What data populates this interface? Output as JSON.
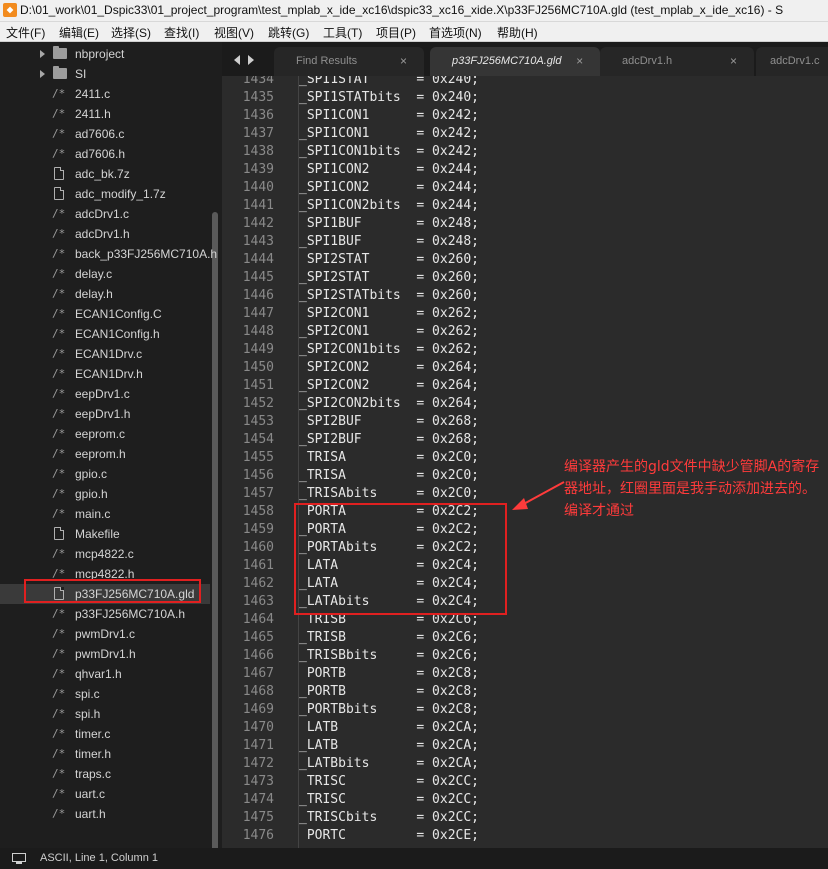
{
  "window": {
    "title": "D:\\01_work\\01_Dspic33\\01_project_program\\test_mplab_x_ide_xc16\\dspic33_xc16_xide.X\\p33FJ256MC710A.gld (test_mplab_x_ide_xc16) - S"
  },
  "menu": [
    "文件(F)",
    "编辑(E)",
    "选择(S)",
    "查找(I)",
    "视图(V)",
    "跳转(G)",
    "工具(T)",
    "项目(P)",
    "首选项(N)",
    "帮助(H)"
  ],
  "sidebar": {
    "items": [
      {
        "label": "nbproject",
        "type": "folder"
      },
      {
        "label": "SI",
        "type": "folder"
      },
      {
        "label": "2411.c",
        "type": "code"
      },
      {
        "label": "2411.h",
        "type": "code"
      },
      {
        "label": "ad7606.c",
        "type": "code"
      },
      {
        "label": "ad7606.h",
        "type": "code"
      },
      {
        "label": "adc_bk.7z",
        "type": "file"
      },
      {
        "label": "adc_modify_1.7z",
        "type": "file"
      },
      {
        "label": "adcDrv1.c",
        "type": "code"
      },
      {
        "label": "adcDrv1.h",
        "type": "code"
      },
      {
        "label": "back_p33FJ256MC710A.h",
        "type": "code"
      },
      {
        "label": "delay.c",
        "type": "code"
      },
      {
        "label": "delay.h",
        "type": "code"
      },
      {
        "label": "ECAN1Config.C",
        "type": "code"
      },
      {
        "label": "ECAN1Config.h",
        "type": "code"
      },
      {
        "label": "ECAN1Drv.c",
        "type": "code"
      },
      {
        "label": "ECAN1Drv.h",
        "type": "code"
      },
      {
        "label": "eepDrv1.c",
        "type": "code"
      },
      {
        "label": "eepDrv1.h",
        "type": "code"
      },
      {
        "label": "eeprom.c",
        "type": "code"
      },
      {
        "label": "eeprom.h",
        "type": "code"
      },
      {
        "label": "gpio.c",
        "type": "code"
      },
      {
        "label": "gpio.h",
        "type": "code"
      },
      {
        "label": "main.c",
        "type": "code"
      },
      {
        "label": "Makefile",
        "type": "file"
      },
      {
        "label": "mcp4822.c",
        "type": "code"
      },
      {
        "label": "mcp4822.h",
        "type": "code"
      },
      {
        "label": "p33FJ256MC710A.gld",
        "type": "file",
        "selected": true
      },
      {
        "label": "p33FJ256MC710A.h",
        "type": "code"
      },
      {
        "label": "pwmDrv1.c",
        "type": "code"
      },
      {
        "label": "pwmDrv1.h",
        "type": "code"
      },
      {
        "label": "qhvar1.h",
        "type": "code"
      },
      {
        "label": "spi.c",
        "type": "code"
      },
      {
        "label": "spi.h",
        "type": "code"
      },
      {
        "label": "timer.c",
        "type": "code"
      },
      {
        "label": "timer.h",
        "type": "code"
      },
      {
        "label": "traps.c",
        "type": "code"
      },
      {
        "label": "uart.c",
        "type": "code"
      },
      {
        "label": "uart.h",
        "type": "code"
      }
    ]
  },
  "tabs": [
    {
      "label": "Find Results",
      "active": false
    },
    {
      "label": "p33FJ256MC710A.gld",
      "active": true
    },
    {
      "label": "adcDrv1.h",
      "active": false
    },
    {
      "label": "adcDrv1.c",
      "active": false
    }
  ],
  "tab_close_glyph": "×",
  "code": [
    {
      "ln": "1434",
      "text": "_SPI1STAT      = 0x240;"
    },
    {
      "ln": "1435",
      "text": "_SPI1STATbits  = 0x240;"
    },
    {
      "ln": "1436",
      "text": " SPI1CON1      = 0x242;"
    },
    {
      "ln": "1437",
      "text": "_SPI1CON1      = 0x242;"
    },
    {
      "ln": "1438",
      "text": "_SPI1CON1bits  = 0x242;"
    },
    {
      "ln": "1439",
      "text": " SPI1CON2      = 0x244;"
    },
    {
      "ln": "1440",
      "text": "_SPI1CON2      = 0x244;"
    },
    {
      "ln": "1441",
      "text": "_SPI1CON2bits  = 0x244;"
    },
    {
      "ln": "1442",
      "text": " SPI1BUF       = 0x248;"
    },
    {
      "ln": "1443",
      "text": "_SPI1BUF       = 0x248;"
    },
    {
      "ln": "1444",
      "text": " SPI2STAT      = 0x260;"
    },
    {
      "ln": "1445",
      "text": "_SPI2STAT      = 0x260;"
    },
    {
      "ln": "1446",
      "text": "_SPI2STATbits  = 0x260;"
    },
    {
      "ln": "1447",
      "text": " SPI2CON1      = 0x262;"
    },
    {
      "ln": "1448",
      "text": "_SPI2CON1      = 0x262;"
    },
    {
      "ln": "1449",
      "text": "_SPI2CON1bits  = 0x262;"
    },
    {
      "ln": "1450",
      "text": " SPI2CON2      = 0x264;"
    },
    {
      "ln": "1451",
      "text": "_SPI2CON2      = 0x264;"
    },
    {
      "ln": "1452",
      "text": "_SPI2CON2bits  = 0x264;"
    },
    {
      "ln": "1453",
      "text": " SPI2BUF       = 0x268;"
    },
    {
      "ln": "1454",
      "text": "_SPI2BUF       = 0x268;"
    },
    {
      "ln": "1455",
      "text": " TRISA         = 0x2C0;"
    },
    {
      "ln": "1456",
      "text": "_TRISA         = 0x2C0;"
    },
    {
      "ln": "1457",
      "text": "_TRISAbits     = 0x2C0;"
    },
    {
      "ln": "1458",
      "text": " PORTA         = 0x2C2;"
    },
    {
      "ln": "1459",
      "text": "_PORTA         = 0x2C2;"
    },
    {
      "ln": "1460",
      "text": "_PORTAbits     = 0x2C2;"
    },
    {
      "ln": "1461",
      "text": " LATA          = 0x2C4;"
    },
    {
      "ln": "1462",
      "text": "_LATA          = 0x2C4;"
    },
    {
      "ln": "1463",
      "text": "_LATAbits      = 0x2C4;"
    },
    {
      "ln": "1464",
      "text": " TRISB         = 0x2C6;"
    },
    {
      "ln": "1465",
      "text": "_TRISB         = 0x2C6;"
    },
    {
      "ln": "1466",
      "text": "_TRISBbits     = 0x2C6;"
    },
    {
      "ln": "1467",
      "text": " PORTB         = 0x2C8;"
    },
    {
      "ln": "1468",
      "text": "_PORTB         = 0x2C8;"
    },
    {
      "ln": "1469",
      "text": "_PORTBbits     = 0x2C8;"
    },
    {
      "ln": "1470",
      "text": " LATB          = 0x2CA;"
    },
    {
      "ln": "1471",
      "text": "_LATB          = 0x2CA;"
    },
    {
      "ln": "1472",
      "text": "_LATBbits      = 0x2CA;"
    },
    {
      "ln": "1473",
      "text": " TRISC         = 0x2CC;"
    },
    {
      "ln": "1474",
      "text": "_TRISC         = 0x2CC;"
    },
    {
      "ln": "1475",
      "text": "_TRISCbits     = 0x2CC;"
    },
    {
      "ln": "1476",
      "text": " PORTC         = 0x2CE;"
    }
  ],
  "annotation": {
    "text": "编译器产生的gld文件中缺少管脚A的寄存器地址，红圈里面是我手动添加进去的。编译才通过",
    "color": "#ff3b3b"
  },
  "status": {
    "text": "ASCII, Line 1, Column 1"
  },
  "colors": {
    "highlight_box": "#e02020",
    "editor_bg": "#2b2b2b",
    "sidebar_bg": "#1e1e1e"
  }
}
